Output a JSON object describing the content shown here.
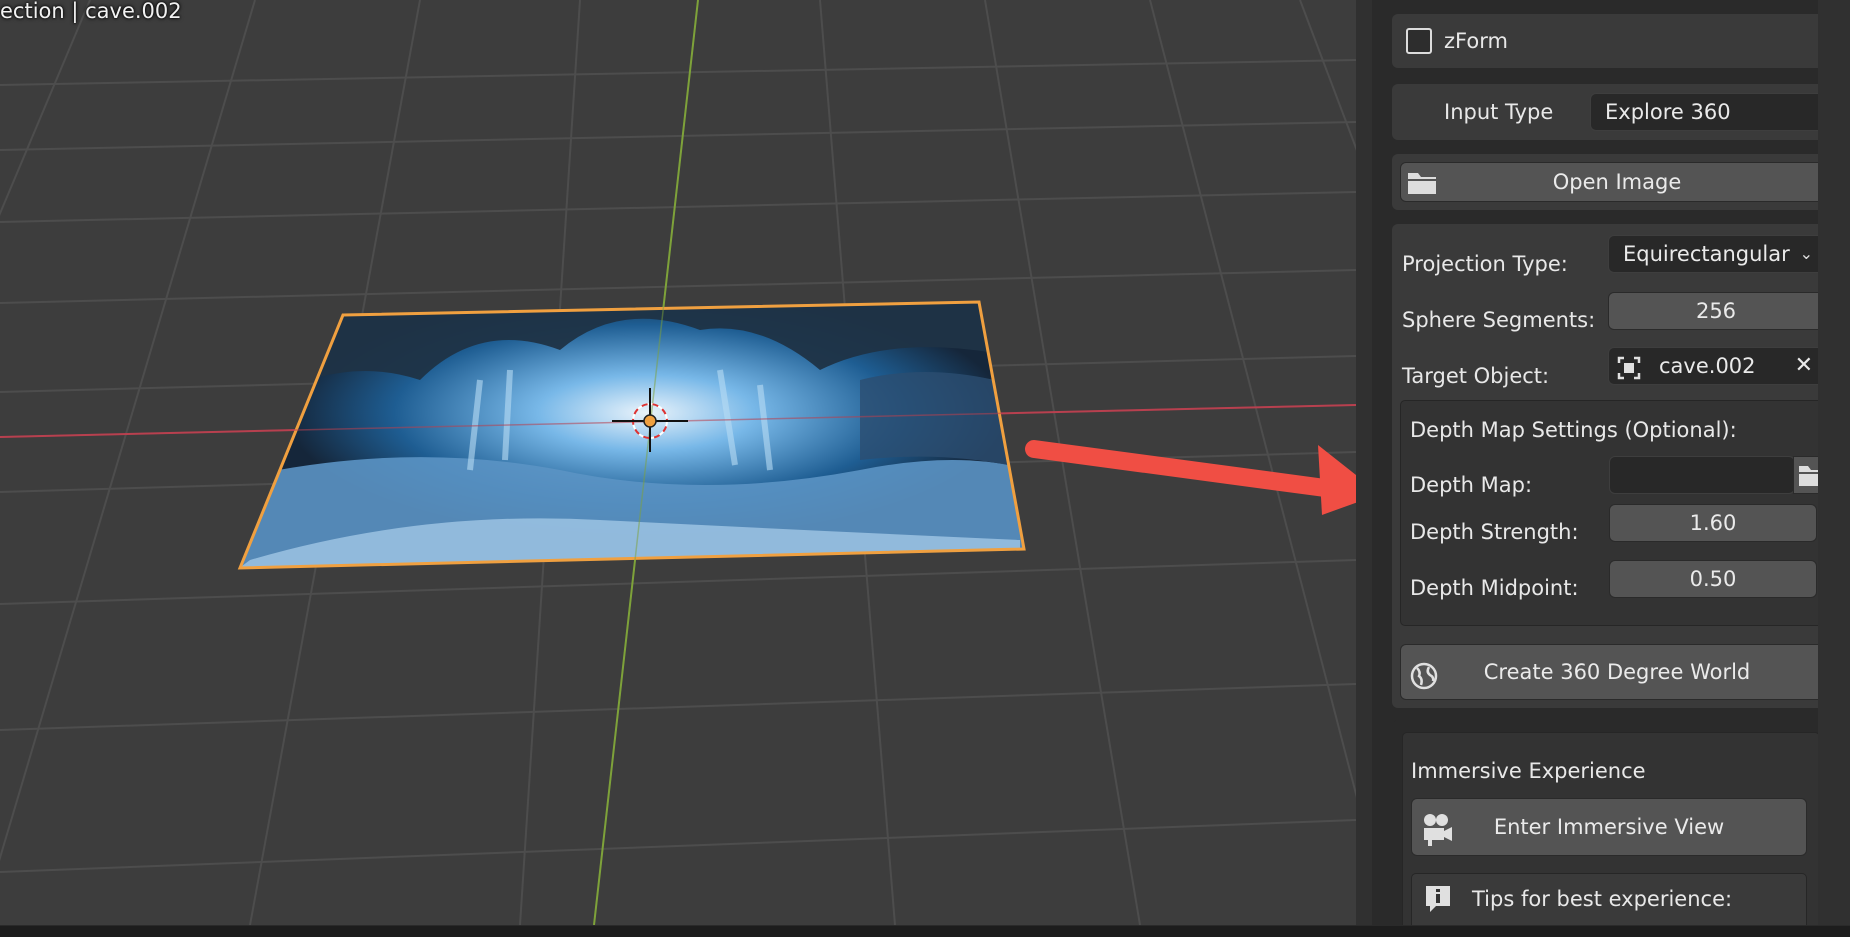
{
  "viewport": {
    "header_text": "ection | cave.002"
  },
  "panel": {
    "addon_title": "zForm",
    "input_type_label": "Input Type",
    "input_type_value": "Explore 360",
    "open_image_label": "Open Image",
    "projection_type_label": "Projection Type:",
    "projection_type_value": "Equirectangular",
    "sphere_segments_label": "Sphere Segments:",
    "sphere_segments_value": "256",
    "target_object_label": "Target Object:",
    "target_object_value": "cave.002",
    "depth_settings_title": "Depth Map Settings (Optional):",
    "depth_map_label": "Depth Map:",
    "depth_map_value": "",
    "depth_strength_label": "Depth Strength:",
    "depth_strength_value": "1.60",
    "depth_midpoint_label": "Depth Midpoint:",
    "depth_midpoint_value": "0.50",
    "create_world_label": "Create 360 Degree World",
    "immersive_title": "Immersive Experience",
    "enter_immersive_label": "Enter Immersive View",
    "tips_label": "Tips for best experience:"
  },
  "colors": {
    "selection_outline": "#f0a040",
    "x_axis": "#c0404f",
    "y_axis": "#7ea23a",
    "annotation_arrow": "#f04e44"
  }
}
